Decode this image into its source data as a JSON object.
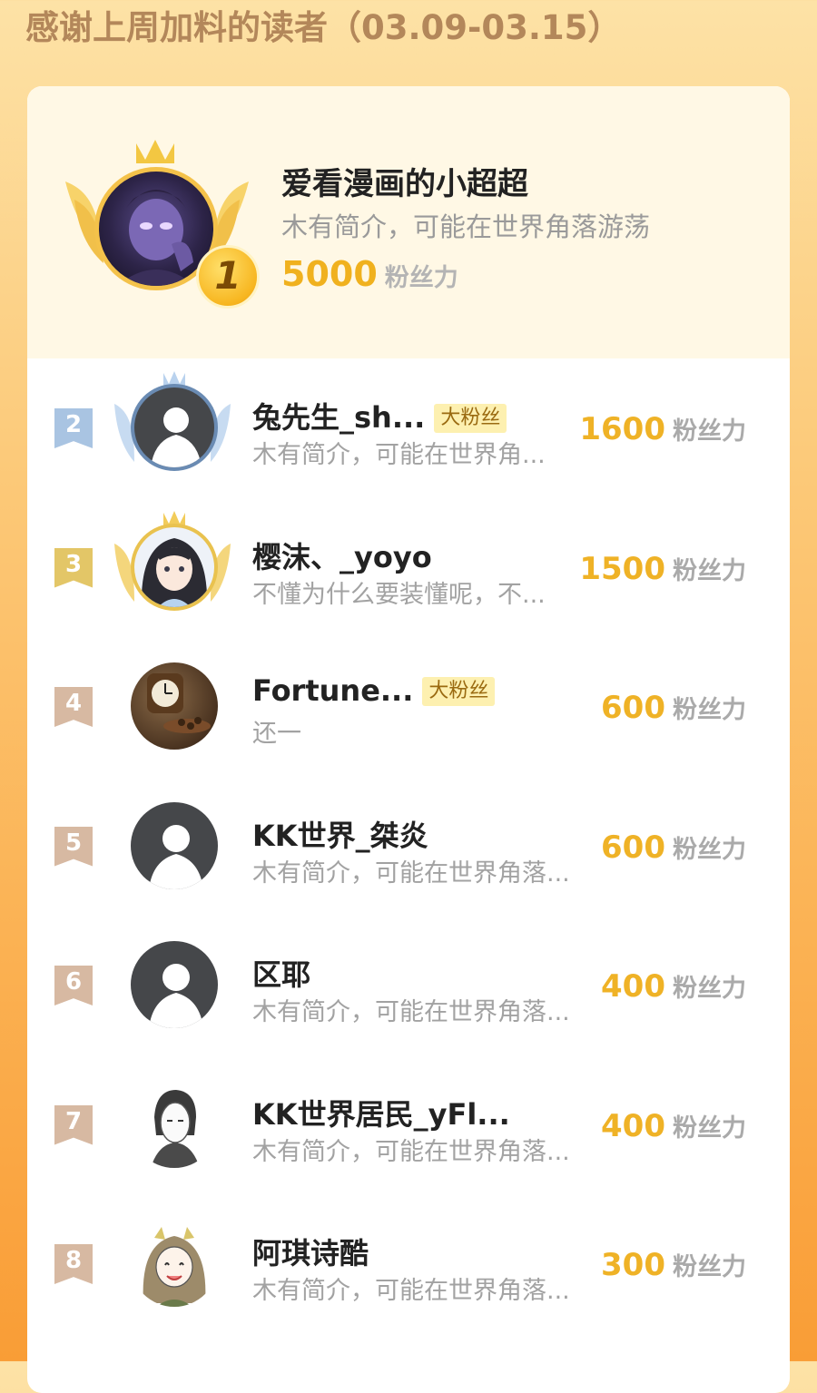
{
  "header": {
    "title": "感谢上周加料的读者（03.09-03.15）"
  },
  "top": {
    "rank": "1",
    "name": "爱看漫画的小超超",
    "bio": "木有简介，可能在世界角落游荡",
    "score": "5000",
    "unit": "粉丝力",
    "icons": [
      "crown-icon",
      "wings-icon",
      "rank-badge"
    ]
  },
  "rows": [
    {
      "rank": "2",
      "name": "兔先生_sh...",
      "badge": "大粉丝",
      "bio": "木有简介，可能在世界角...",
      "score": "1600",
      "unit": "粉丝力",
      "tag_color": "#a9c4e2",
      "avatar": "default-avatar"
    },
    {
      "rank": "3",
      "name": "樱沫、_yoyo",
      "badge": "",
      "bio": "不懂为什么要装懂呢，不...",
      "score": "1500",
      "unit": "粉丝力",
      "tag_color": "#e3c667",
      "avatar": "anime-girl-avatar"
    },
    {
      "rank": "4",
      "name": "Fortune...",
      "badge": "大粉丝",
      "bio": "还一",
      "score": "600",
      "unit": "粉丝力",
      "tag_color": "#d7b9a2",
      "avatar": "clock-avatar"
    },
    {
      "rank": "5",
      "name": "KK世界_桀炎",
      "badge": "",
      "bio": "木有简介，可能在世界角落...",
      "score": "600",
      "unit": "粉丝力",
      "tag_color": "#d7b9a2",
      "avatar": "default-avatar"
    },
    {
      "rank": "6",
      "name": "区耶",
      "badge": "",
      "bio": "木有简介，可能在世界角落...",
      "score": "400",
      "unit": "粉丝力",
      "tag_color": "#d7b9a2",
      "avatar": "default-avatar"
    },
    {
      "rank": "7",
      "name": "KK世界居民_yFl...",
      "badge": "",
      "bio": "木有简介，可能在世界角落...",
      "score": "400",
      "unit": "粉丝力",
      "tag_color": "#d7b9a2",
      "avatar": "sketch-avatar"
    },
    {
      "rank": "8",
      "name": "阿琪诗酷",
      "badge": "",
      "bio": "木有简介，可能在世界角落...",
      "score": "300",
      "unit": "粉丝力",
      "tag_color": "#d7b9a2",
      "avatar": "anime-girl-avatar"
    }
  ],
  "colors": {
    "score": "#efb226",
    "header": "#b3875a",
    "badge_bg": "#fdf0b0"
  }
}
